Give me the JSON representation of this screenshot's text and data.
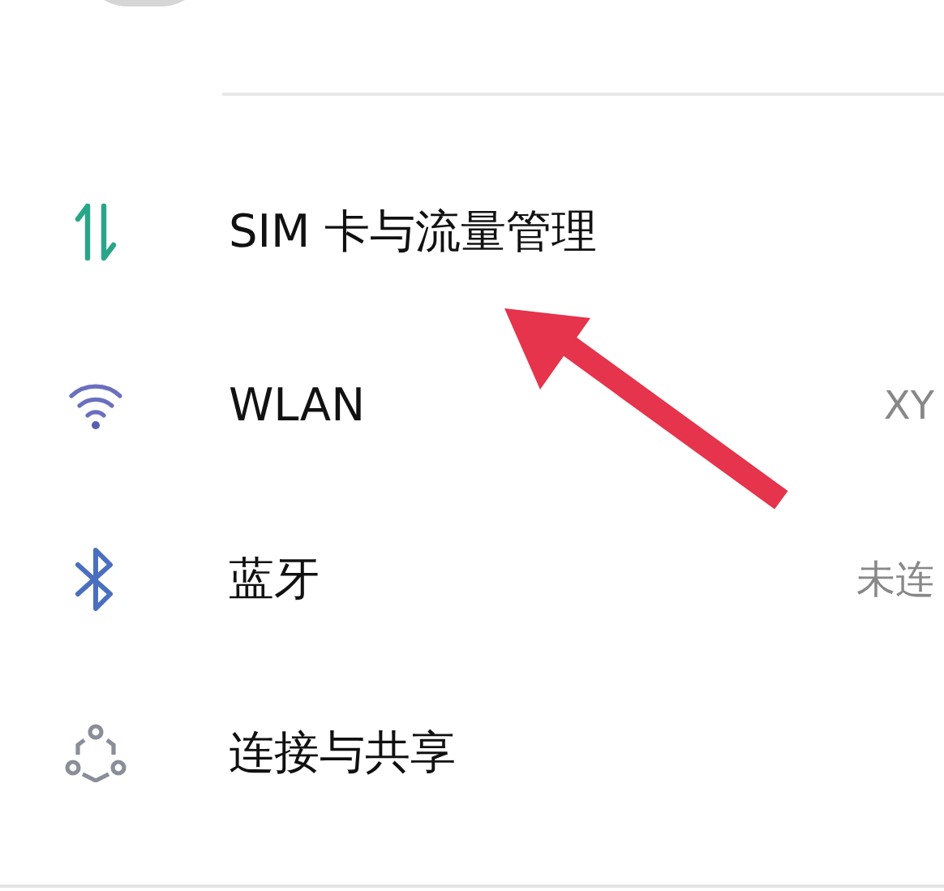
{
  "settings_items": [
    {
      "kind": "sim",
      "label": "SIM 卡与流量管理"
    },
    {
      "kind": "wifi",
      "label": "WLAN",
      "value": "XY"
    },
    {
      "kind": "bluetooth",
      "label": "蓝牙",
      "value": "未连"
    },
    {
      "kind": "share",
      "label": "连接与共享"
    }
  ]
}
